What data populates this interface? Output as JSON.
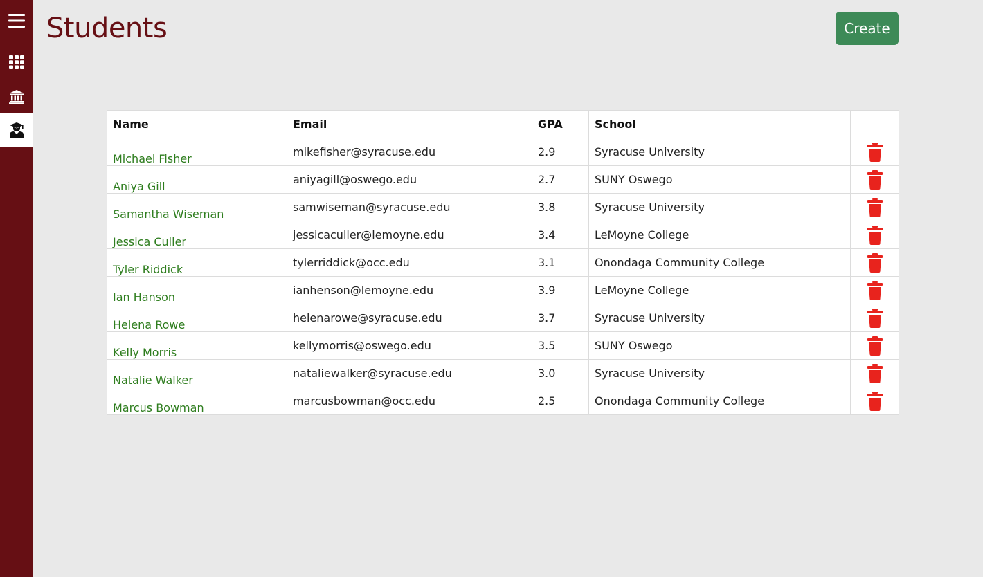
{
  "page": {
    "title": "Students"
  },
  "actions": {
    "create_label": "Create"
  },
  "sidebar": {
    "items": [
      {
        "icon": "hamburger-menu-icon"
      },
      {
        "icon": "grid-icon"
      },
      {
        "icon": "bank-building-icon"
      },
      {
        "icon": "graduate-icon",
        "active": true
      }
    ]
  },
  "table": {
    "headers": {
      "name": "Name",
      "email": "Email",
      "gpa": "GPA",
      "school": "School"
    },
    "rows": [
      {
        "name": "Michael Fisher",
        "email": "mikefisher@syracuse.edu",
        "gpa": "2.9",
        "school": "Syracuse University"
      },
      {
        "name": "Aniya Gill",
        "email": "aniyagill@oswego.edu",
        "gpa": "2.7",
        "school": "SUNY Oswego"
      },
      {
        "name": "Samantha Wiseman",
        "email": "samwiseman@syracuse.edu",
        "gpa": "3.8",
        "school": "Syracuse University"
      },
      {
        "name": "Jessica Culler",
        "email": "jessicaculler@lemoyne.edu",
        "gpa": "3.4",
        "school": "LeMoyne College"
      },
      {
        "name": "Tyler Riddick",
        "email": "tylerriddick@occ.edu",
        "gpa": "3.1",
        "school": "Onondaga Community College"
      },
      {
        "name": "Ian Hanson",
        "email": "ianhenson@lemoyne.edu",
        "gpa": "3.9",
        "school": "LeMoyne College"
      },
      {
        "name": "Helena Rowe",
        "email": "helenarowe@syracuse.edu",
        "gpa": "3.7",
        "school": "Syracuse University"
      },
      {
        "name": "Kelly Morris",
        "email": "kellymorris@oswego.edu",
        "gpa": "3.5",
        "school": "SUNY Oswego"
      },
      {
        "name": "Natalie Walker",
        "email": "nataliewalker@syracuse.edu",
        "gpa": "3.0",
        "school": "Syracuse University"
      },
      {
        "name": "Marcus Bowman",
        "email": "marcusbowman@occ.edu",
        "gpa": "2.5",
        "school": "Onondaga Community College"
      }
    ]
  },
  "colors": {
    "sidebar": "#660f14",
    "title": "#660f14",
    "create_button": "#3d8a57",
    "name_link": "#2e7d1e",
    "delete_icon": "#e8231d",
    "background": "#e9e9e9"
  }
}
